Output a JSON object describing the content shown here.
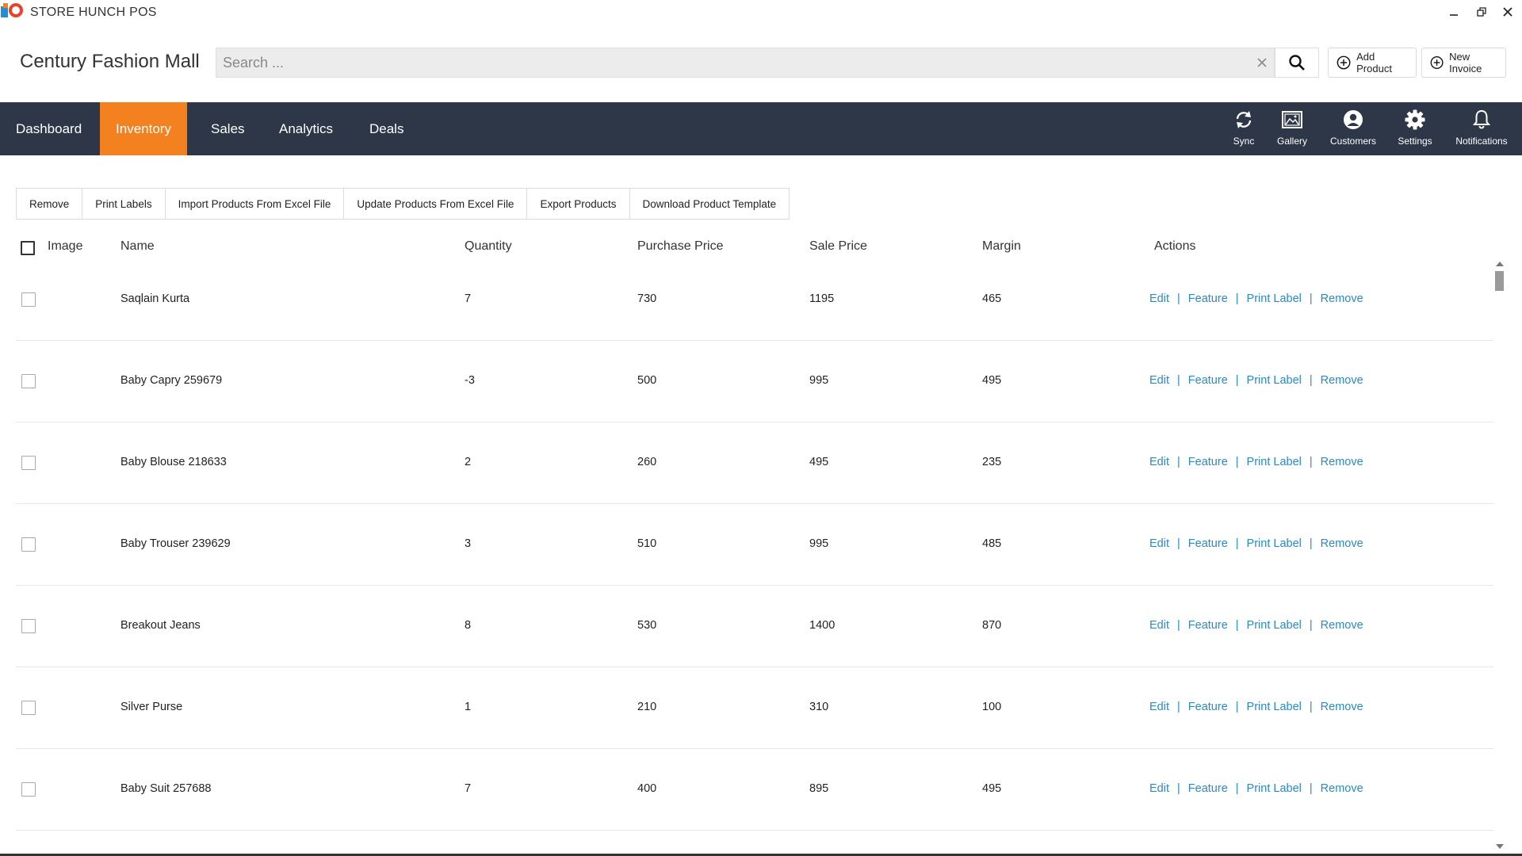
{
  "window": {
    "title": "STORE HUNCH POS",
    "minimize_label": "–",
    "restore_label": "❐",
    "close_label": "✕"
  },
  "header": {
    "store_name": "Century Fashion Mall",
    "search_placeholder": "Search ...",
    "search_value": "",
    "add_product_label": "Add Product",
    "new_invoice_label": "New Invoice"
  },
  "nav": {
    "tabs": [
      {
        "label": "Dashboard"
      },
      {
        "label": "Inventory"
      },
      {
        "label": "Sales"
      },
      {
        "label": "Analytics"
      },
      {
        "label": "Deals"
      }
    ],
    "active_tab": "Inventory",
    "icons": [
      {
        "label": "Sync",
        "icon": "sync-icon"
      },
      {
        "label": "Gallery",
        "icon": "gallery-icon"
      },
      {
        "label": "Customers",
        "icon": "user-icon"
      },
      {
        "label": "Settings",
        "icon": "gear-icon"
      },
      {
        "label": "Notifications",
        "icon": "bell-icon"
      }
    ]
  },
  "toolbar": {
    "buttons": [
      {
        "label": "Remove"
      },
      {
        "label": "Print Labels"
      },
      {
        "label": "Import Products From Excel File"
      },
      {
        "label": "Update Products From Excel File"
      },
      {
        "label": "Export Products"
      },
      {
        "label": "Download Product Template"
      }
    ]
  },
  "table": {
    "columns": [
      "Image",
      "Name",
      "Quantity",
      "Purchase Price",
      "Sale Price",
      "Margin",
      "Actions"
    ],
    "actions": [
      "Edit",
      "Feature",
      "Print Label",
      "Remove"
    ],
    "separator": "|",
    "rows": [
      {
        "name": "Saqlain Kurta",
        "quantity": "7",
        "purchase_price": "730",
        "sale_price": "1195",
        "margin": "465"
      },
      {
        "name": "Baby Capry 259679",
        "quantity": "-3",
        "purchase_price": "500",
        "sale_price": "995",
        "margin": "495"
      },
      {
        "name": "Baby Blouse 218633",
        "quantity": "2",
        "purchase_price": "260",
        "sale_price": "495",
        "margin": "235"
      },
      {
        "name": "Baby Trouser 239629",
        "quantity": "3",
        "purchase_price": "510",
        "sale_price": "995",
        "margin": "485"
      },
      {
        "name": "Breakout Jeans",
        "quantity": "8",
        "purchase_price": "530",
        "sale_price": "1400",
        "margin": "870"
      },
      {
        "name": "Silver Purse",
        "quantity": "1",
        "purchase_price": "210",
        "sale_price": "310",
        "margin": "100"
      },
      {
        "name": "Baby Suit 257688",
        "quantity": "7",
        "purchase_price": "400",
        "sale_price": "895",
        "margin": "495"
      }
    ]
  },
  "colors": {
    "nav_bg": "#2d3748",
    "active_tab": "#f48120",
    "link": "#2a8ac6"
  }
}
